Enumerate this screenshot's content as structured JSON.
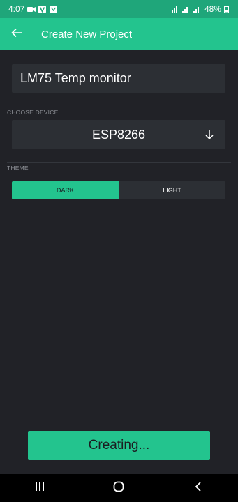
{
  "status_bar": {
    "time": "4:07",
    "battery": "48%",
    "left_icons": [
      "video-icon",
      "v-app-icon",
      "chat-app-icon"
    ],
    "right_icons": [
      "signal-4g-icon",
      "signal-bars-icon",
      "signal-bars-icon",
      "battery-icon"
    ]
  },
  "app_bar": {
    "title": "Create New Project",
    "back_icon": "arrow-left-icon"
  },
  "project": {
    "name_value": "LM75 Temp monitor"
  },
  "device": {
    "section_label": "CHOOSE DEVICE",
    "selected": "ESP8266",
    "arrow_icon": "arrow-down-icon"
  },
  "theme": {
    "section_label": "THEME",
    "options": [
      "DARK",
      "LIGHT"
    ],
    "selected": "DARK"
  },
  "action": {
    "create_label": "Creating..."
  },
  "nav_bar": {
    "icons": [
      "recent-apps-icon",
      "home-icon",
      "back-icon"
    ]
  },
  "colors": {
    "accent": "#23c48e",
    "status_bar": "#1fa67a",
    "background": "#212227",
    "field": "#2c2f34",
    "label": "#8b8e94"
  }
}
